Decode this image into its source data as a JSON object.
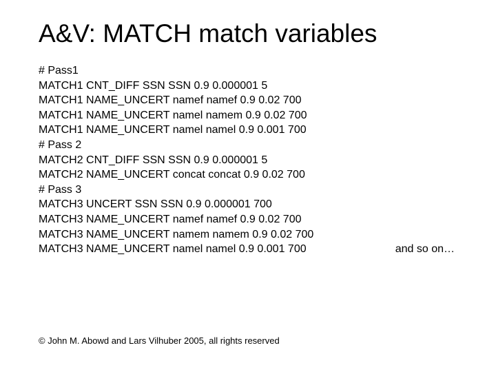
{
  "title": "A&V: MATCH match variables",
  "lines": [
    "# Pass1",
    "MATCH1 CNT_DIFF SSN SSN 0.9 0.000001 5",
    "MATCH1 NAME_UNCERT namef namef 0.9 0.02 700",
    "MATCH1 NAME_UNCERT namel namem 0.9 0.02 700",
    "MATCH1 NAME_UNCERT namel namel 0.9 0.001 700",
    "# Pass 2",
    "MATCH2 CNT_DIFF SSN SSN 0.9 0.000001 5",
    "MATCH2 NAME_UNCERT concat concat 0.9 0.02 700",
    "# Pass 3",
    "MATCH3 UNCERT SSN SSN 0.9 0.000001 700",
    "MATCH3 NAME_UNCERT namef namef 0.9 0.02 700",
    "MATCH3 NAME_UNCERT namem namem 0.9 0.02 700",
    "MATCH3 NAME_UNCERT namel namel 0.9 0.001 700"
  ],
  "note": "and so on…",
  "footer": "© John M. Abowd and Lars Vilhuber 2005, all rights reserved"
}
